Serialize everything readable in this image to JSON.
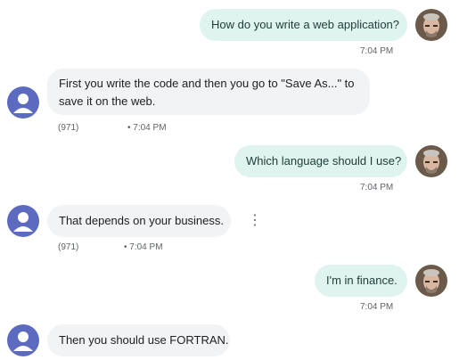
{
  "messages": [
    {
      "dir": "out",
      "text": "How do you write a web application?",
      "time": "7:04 PM"
    },
    {
      "dir": "in",
      "lines": [
        "First you write the code and then you go to \"Save As...\" to",
        "save it on the web."
      ],
      "sender": "(971)",
      "time": "• 7:04 PM"
    },
    {
      "dir": "out",
      "text": "Which language should I use?",
      "time": "7:04 PM"
    },
    {
      "dir": "in",
      "text": "That depends on your business.",
      "sender": "(971)",
      "time": "• 7:04 PM"
    },
    {
      "dir": "out",
      "text": "I'm in finance.",
      "time": "7:04 PM"
    },
    {
      "dir": "in",
      "text": "Then you should use FORTRAN."
    }
  ],
  "icons": {
    "more": "more-vert-icon",
    "avatar_user": "user-photo-avatar",
    "avatar_other": "person-icon"
  },
  "colors": {
    "outgoing_bubble": "#dff3ef",
    "incoming_bubble": "#f1f3f4",
    "avatar": "#5c6bc0"
  }
}
